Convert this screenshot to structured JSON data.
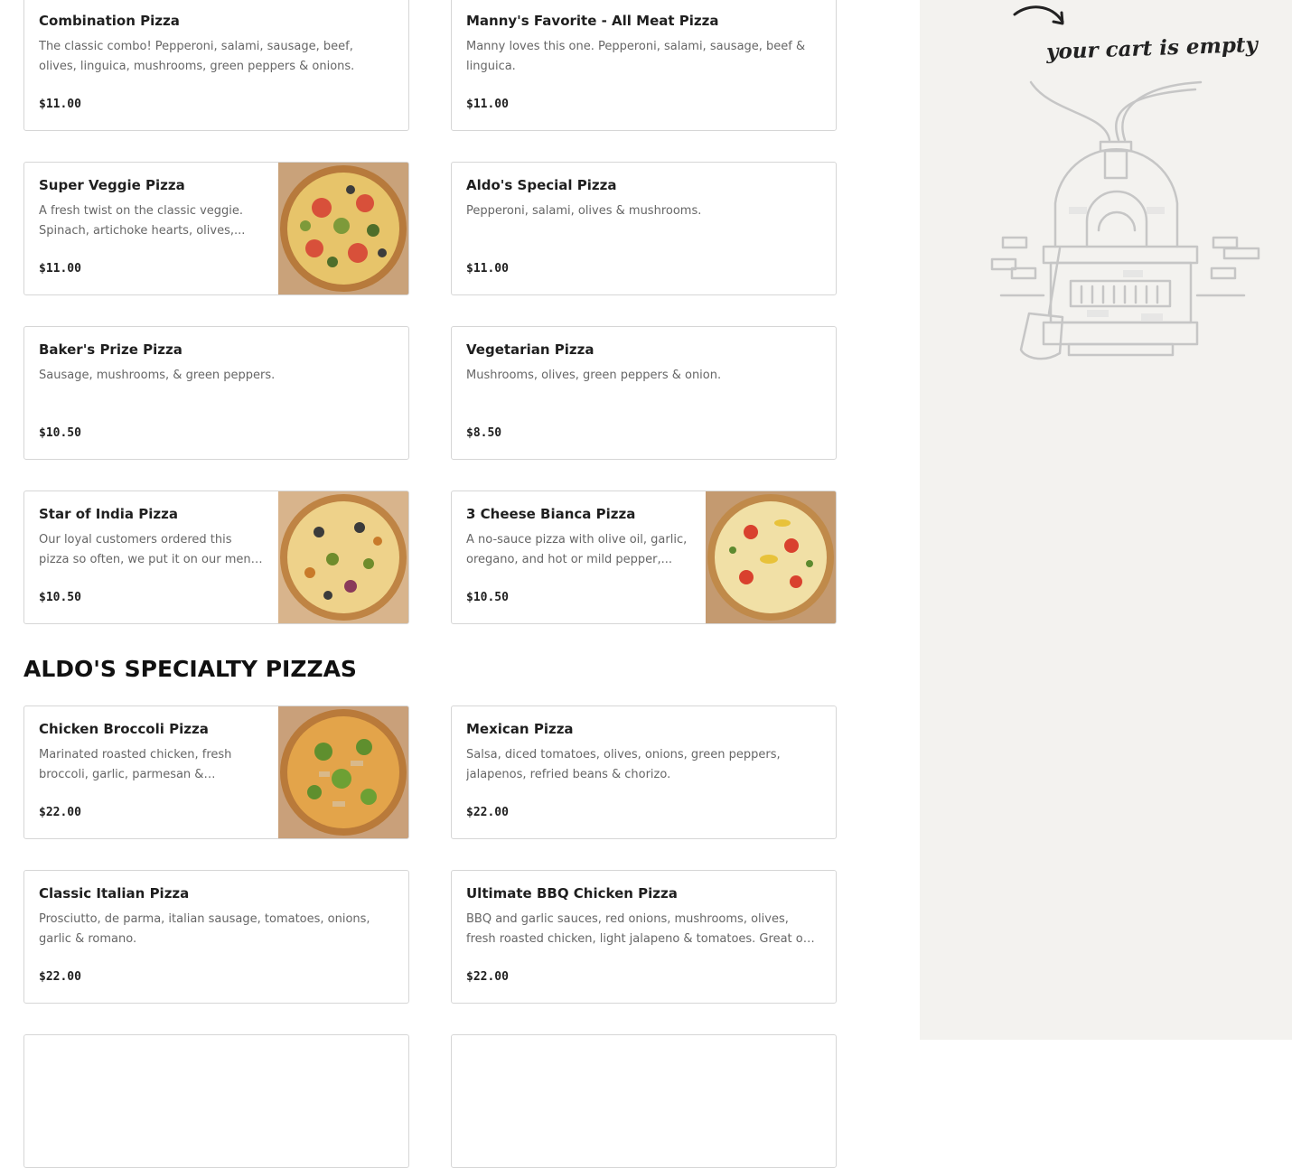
{
  "menu": {
    "cards": [
      {
        "name": "Combination Pizza",
        "desc": "The classic combo! Pepperoni, salami, sausage, beef, olives, linguica, mushrooms, green peppers & onions.",
        "price": "$11.00"
      },
      {
        "name": "Manny's Favorite - All Meat Pizza",
        "desc": "Manny loves this one. Pepperoni, salami, sausage, beef & linguica.",
        "price": "$11.00"
      },
      {
        "name": "Super Veggie Pizza",
        "desc": "A fresh twist on the classic veggie. Spinach, artichoke hearts, olives,...",
        "price": "$11.00",
        "image": "veggie-pizza-photo"
      },
      {
        "name": "Aldo's Special Pizza",
        "desc": "Pepperoni, salami, olives & mushrooms.",
        "price": "$11.00"
      },
      {
        "name": "Baker's Prize Pizza",
        "desc": "Sausage, mushrooms, & green peppers.",
        "price": "$10.50"
      },
      {
        "name": "Vegetarian Pizza",
        "desc": "Mushrooms, olives, green peppers & onion.",
        "price": "$8.50"
      },
      {
        "name": "Star of India Pizza",
        "desc": "Our loyal customers ordered this pizza so often, we put it on our menu! Gree...",
        "price": "$10.50",
        "image": "star-of-india-pizza-photo"
      },
      {
        "name": "3 Cheese Bianca Pizza",
        "desc": "A no-sauce pizza with olive oil, garlic, oregano, and hot or mild pepper,...",
        "price": "$10.50",
        "image": "bianca-pizza-photo"
      }
    ],
    "section_title": "ALDO'S SPECIALTY PIZZAS",
    "specialty_cards": [
      {
        "name": "Chicken Broccoli Pizza",
        "desc": "Marinated roasted chicken, fresh broccoli, garlic, parmesan & romano,...",
        "price": "$22.00",
        "image": "chicken-broccoli-pizza-photo"
      },
      {
        "name": "Mexican Pizza",
        "desc": "Salsa, diced tomatoes, olives, onions, green peppers, jalapenos, refried beans & chorizo.",
        "price": "$22.00"
      },
      {
        "name": "Classic Italian Pizza",
        "desc": "Prosciutto, de parma, italian sausage, tomatoes, onions, garlic & romano.",
        "price": "$22.00"
      },
      {
        "name": "Ultimate BBQ Chicken Pizza",
        "desc": "BBQ and garlic sauces, red onions, mushrooms, olives, fresh roasted chicken, light jalapeno & tomatoes. Great on our thic...",
        "price": "$22.00"
      }
    ]
  },
  "cart": {
    "empty_text": "your cart is empty",
    "illustration": "pizza-oven-illustration"
  },
  "colors": {
    "sidebar_bg": "#f3f2ef",
    "card_border": "#d6d6d6",
    "text": "#1f1f1f",
    "muted": "#666666"
  }
}
